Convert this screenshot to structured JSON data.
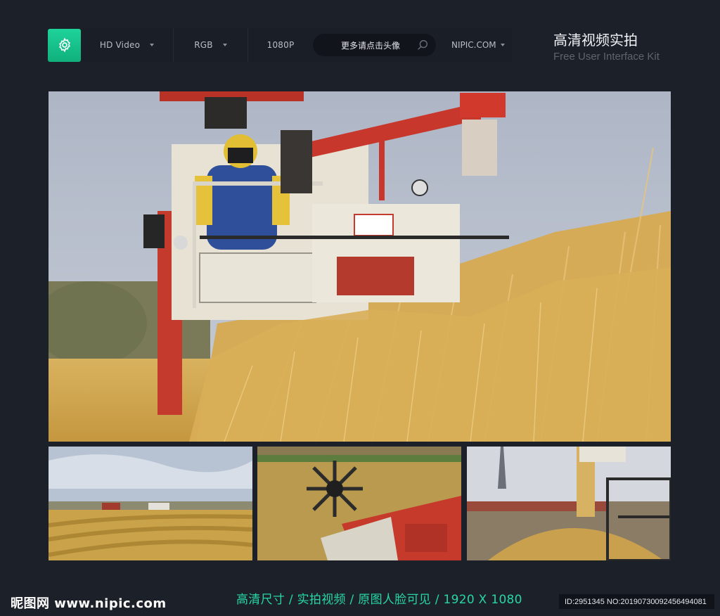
{
  "toolbar": {
    "settings_icon": "gear-icon",
    "format": "HD Video",
    "color_mode": "RGB",
    "resolution": "1080P",
    "search_text": "更多请点击头像",
    "search_icon": "search-icon",
    "site": "NIPIC.COM"
  },
  "heading": {
    "title": "高清视频实拍",
    "subtitle": "Free User Interface Kit"
  },
  "images": {
    "main": "combine-harvester-close-up",
    "thumb_1": "harvested-field-rows",
    "thumb_2": "harvester-reel-header",
    "thumb_3": "grain-unloading-pile"
  },
  "footer": {
    "specs": "高清尺寸 / 实拍视频 / 原图人脸可见 / 1920 X 1080",
    "logo": "昵图网 www.nipic.com",
    "id_text": "ID:2951345 NO:20190730092456494081"
  },
  "colors": {
    "accent": "#1ec890",
    "background": "#1c2029"
  }
}
